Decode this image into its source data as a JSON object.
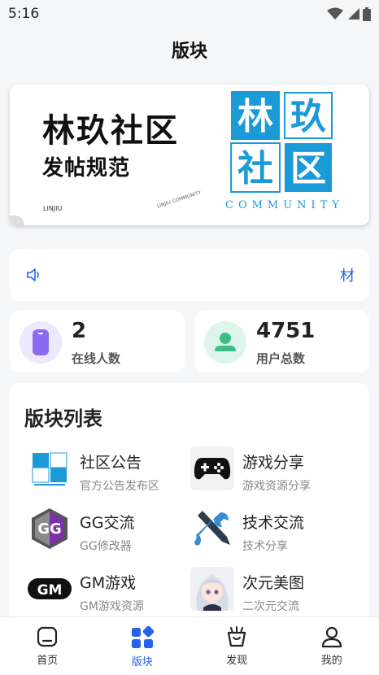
{
  "status_bar": {
    "time": "5:16"
  },
  "header": {
    "title": "版块"
  },
  "banner": {
    "title": "林玖社区",
    "subtitle": "发帖规范",
    "small_text": "LINJIU",
    "tiny_text": "LINJIU COMMUNITY",
    "logo_chars": [
      "林",
      "玖",
      "社",
      "区"
    ],
    "community": "COMMUNITY",
    "accent_color": "#1a9ad6"
  },
  "notice": {
    "marquee_text": "材"
  },
  "stats": [
    {
      "value": "2",
      "label": "在线人数",
      "icon": "phone-icon",
      "color": "#8b6cf0"
    },
    {
      "value": "4751",
      "label": "用户总数",
      "icon": "user-icon",
      "color": "#3bbf85"
    }
  ],
  "sections": {
    "title": "版块列表",
    "items": [
      {
        "name": "社区公告",
        "desc": "官方公告发布区",
        "icon": "community-logo-icon"
      },
      {
        "name": "游戏分享",
        "desc": "游戏资源分享",
        "icon": "gamepad-icon"
      },
      {
        "name": "GG交流",
        "desc": "GG修改器",
        "icon": "gg-logo-icon"
      },
      {
        "name": "技术交流",
        "desc": "技术分享",
        "icon": "tools-icon"
      },
      {
        "name": "GM游戏",
        "desc": "GM游戏资源",
        "icon": "gm-logo-icon"
      },
      {
        "name": "次元美图",
        "desc": "二次元交流",
        "icon": "anime-avatar-icon"
      }
    ]
  },
  "tabbar": {
    "items": [
      {
        "label": "首页",
        "icon": "home-icon"
      },
      {
        "label": "版块",
        "icon": "grid-icon",
        "active": true
      },
      {
        "label": "发现",
        "icon": "discover-icon"
      },
      {
        "label": "我的",
        "icon": "profile-icon"
      }
    ],
    "active_color": "#2563eb"
  }
}
